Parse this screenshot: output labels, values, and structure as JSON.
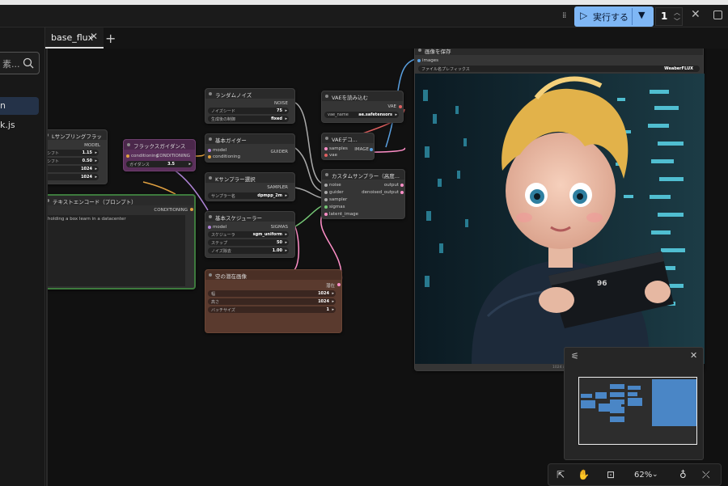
{
  "topbar": {
    "run_label": "実行する",
    "queue_count": "1"
  },
  "sidebar": {
    "search_placeholder": "素...",
    "items": [
      {
        "label": "n"
      },
      {
        "label": "k.js"
      }
    ]
  },
  "tabs": [
    {
      "label": "base_flux"
    }
  ],
  "nodes": {
    "sampler_flux": {
      "title": "Lサンプリングフラッ",
      "rows": [
        [
          "シフト",
          "1.15"
        ],
        [
          "シフト",
          "0.50"
        ],
        [
          "",
          "1024"
        ],
        [
          "",
          "1024"
        ]
      ],
      "output": "MODEL"
    },
    "flux_guidance": {
      "title": "フラックスガイダンス",
      "in": "conditioning",
      "out": "CONDITIONING",
      "widget_label": "ガイダンス",
      "widget_value": "3.5"
    },
    "text_encode": {
      "title": "テキストエンコード（プロンプト）",
      "out": "CONDITIONING",
      "text": "holding a box learn in a datacenter"
    },
    "random_noise": {
      "title": "ランダムノイズ",
      "out": "NOISE",
      "w1_label": "ノイズシード",
      "w1_value": "75",
      "w2_label": "生成後の制御",
      "w2_value": "fixed"
    },
    "basic_guider": {
      "title": "基本ガイダー",
      "in1": "model",
      "in2": "conditioning",
      "out": "GUIDER"
    },
    "ksampler_select": {
      "title": "Kサンプラー選択",
      "out": "SAMPLER",
      "w_label": "サンプラー名",
      "w_value": "dpmpp_2m"
    },
    "basic_scheduler": {
      "title": "基本スケジューラー",
      "in": "model",
      "out": "SIGMAS",
      "rows": [
        [
          "スケジューラ",
          "sgm_uniform"
        ],
        [
          "ステップ",
          "50"
        ],
        [
          "ノイズ除去",
          "1.00"
        ]
      ]
    },
    "empty_latent": {
      "title": "空の潜在画像",
      "out": "潜在",
      "rows": [
        [
          "幅",
          "1024"
        ],
        [
          "高さ",
          "1024"
        ],
        [
          "バッチサイズ",
          "1"
        ]
      ]
    },
    "vae_loader": {
      "title": "VAEを読み込む",
      "out": "VAE",
      "w_label": "vae_name",
      "w_value": "ae.safetensors"
    },
    "vae_decode": {
      "title": "VAEデコ...",
      "in1": "samples",
      "in2": "vae",
      "out": "IMAGE"
    },
    "custom_sampler": {
      "title": "カスタムサンプラー（高度...",
      "inputs": [
        "noise",
        "guider",
        "sampler",
        "sigmas",
        "latent_image"
      ],
      "outputs": [
        "output",
        "denoised_output"
      ]
    },
    "save_image": {
      "title": "画像を保存",
      "in": "images",
      "w_label": "ファイル名プレフィックス",
      "w_value": "WeaberFLUX",
      "caption": "1024 x 1024"
    }
  },
  "bottom_toolbar": {
    "zoom": "62%"
  },
  "colors": {
    "accent": "#7fb7f5",
    "guidance_node": "#5a2f5a",
    "encode_node_border": "#3d7a3d",
    "latent_node": "#5a3a2e",
    "minimap_nodes": "#4a86c6"
  }
}
